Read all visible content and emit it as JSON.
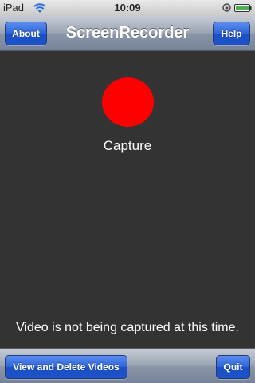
{
  "status_bar": {
    "carrier": "iPad",
    "time": "10:09",
    "icons": [
      "wifi-icon",
      "lock-rotation-icon",
      "battery-icon"
    ]
  },
  "nav_bar": {
    "title": "ScreenRecorder",
    "left_button": "About",
    "right_button": "Help"
  },
  "main": {
    "capture_label": "Capture",
    "capture_color": "#ff0000",
    "status_message": "Video is not being captured at this time."
  },
  "toolbar": {
    "left_button": "View and Delete Videos",
    "right_button": "Quit"
  },
  "colors": {
    "background": "#333333",
    "button_blue": "#2e63d6",
    "bar_gray": "#9aa4b2"
  }
}
